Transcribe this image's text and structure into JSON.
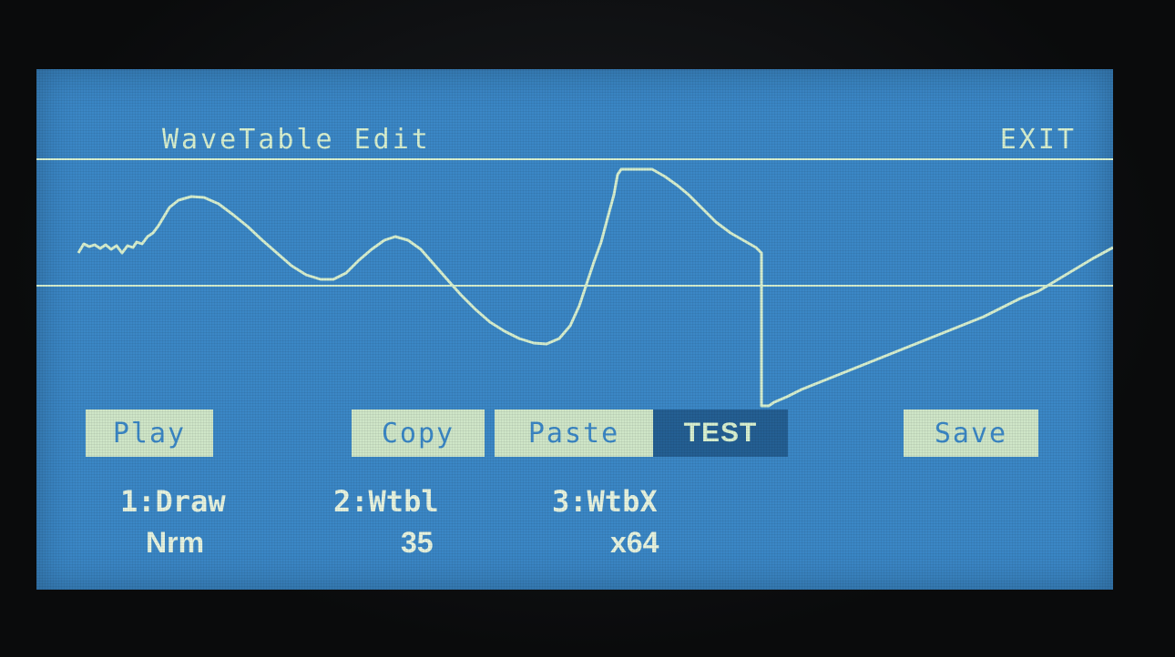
{
  "header": {
    "title": "WaveTable Edit",
    "exit_label": "EXIT"
  },
  "buttons": {
    "play": "Play",
    "copy": "Copy",
    "paste": "Paste",
    "test": "TEST",
    "save": "Save"
  },
  "params": [
    {
      "label": "1:Draw",
      "value": "Nrm"
    },
    {
      "label": "2:Wtbl",
      "value": "35"
    },
    {
      "label": "3:WtbX",
      "value": "x64"
    }
  ],
  "colors": {
    "screen": "#3b87c6",
    "foreground": "#d8f0d0",
    "button_fill": "#cfe6c8",
    "button_selected": "#245f93"
  }
}
